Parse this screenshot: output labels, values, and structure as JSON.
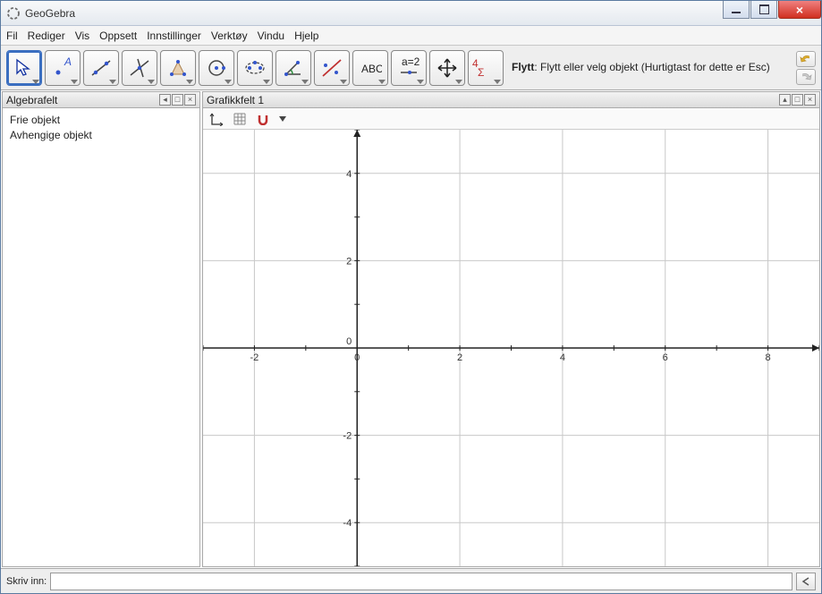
{
  "app_title": "GeoGebra",
  "menu": {
    "fil": "Fil",
    "rediger": "Rediger",
    "vis": "Vis",
    "oppsett": "Oppsett",
    "innstillinger": "Innstillinger",
    "verktoy": "Verktøy",
    "vindu": "Vindu",
    "hjelp": "Hjelp"
  },
  "tool_hint": {
    "name": "Flytt",
    "text": ": Flytt eller velg objekt (Hurtigtast for dette er Esc)"
  },
  "panels": {
    "algebra": {
      "title": "Algebrafelt",
      "free": "Frie objekt",
      "dependent": "Avhengige objekt"
    },
    "graphics": {
      "title": "Grafikkfelt 1"
    }
  },
  "input": {
    "label": "Skriv inn:",
    "value": ""
  },
  "chart_data": {
    "type": "line",
    "series": [],
    "xlim": [
      -3,
      9
    ],
    "ylim": [
      -5,
      5
    ],
    "xticks": [
      -2,
      0,
      2,
      4,
      6,
      8
    ],
    "yticks": [
      -4,
      -2,
      0,
      2,
      4
    ],
    "grid_step": 2,
    "title": "",
    "xlabel": "",
    "ylabel": ""
  }
}
